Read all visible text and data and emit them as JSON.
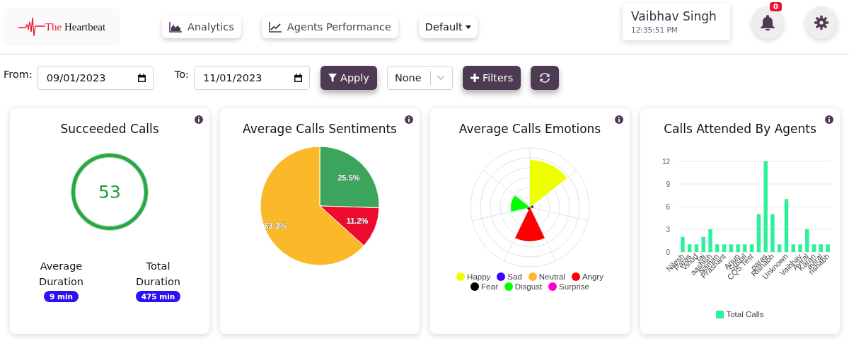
{
  "logo": {
    "prefix": "The",
    "name": "Heartbeat"
  },
  "nav": [
    {
      "label": "Analytics",
      "kind": "area"
    },
    {
      "label": "Agents Performance",
      "kind": "line"
    },
    {
      "label": "Default",
      "kind": "dropdown"
    }
  ],
  "user": {
    "name": "Vaibhav Singh",
    "time": "12:35:51 PM"
  },
  "notifications": {
    "count": "0"
  },
  "filters": {
    "from_label": "From:",
    "from_value": "09/01/2023",
    "to_label": "To:",
    "to_value": "11/01/2023",
    "apply": "Apply",
    "select_value": "None",
    "filters": "Filters"
  },
  "cards": [
    {
      "kind": "summary",
      "title": "Succeeded Calls",
      "value": "53",
      "stats": [
        {
          "label": "Average Duration",
          "value": "9 min"
        },
        {
          "label": "Total Duration",
          "value": "475 min"
        }
      ]
    },
    {
      "kind": "pie",
      "title": "Average Calls Sentiments",
      "chart_data": {
        "type": "pie",
        "values": [
          25.5,
          11.2,
          63.3
        ],
        "data_labels": true,
        "value_labels": [
          "25.5%",
          "11.2%",
          "63.3%"
        ]
      }
    },
    {
      "kind": "polar",
      "title": "Average Calls Emotions",
      "legend": [
        {
          "label": "Happy",
          "color": "#eeff00"
        },
        {
          "label": "Sad",
          "color": "#3c00ff"
        },
        {
          "label": "Neutral",
          "color": "#fbb829"
        },
        {
          "label": "Angry",
          "color": "#ff0000"
        },
        {
          "label": "Fear",
          "color": "#000000"
        },
        {
          "label": "Disgust",
          "color": "#00ff00"
        },
        {
          "label": "Surprise",
          "color": "#ff00cc"
        }
      ]
    },
    {
      "kind": "bar",
      "title": "Calls Attended By Agents",
      "chart_data": {
        "type": "bar",
        "categories": [
          "Nilesh",
          "Paras",
          "Vinod",
          "Jai",
          "aashish",
          "Naman",
          "Prashant",
          null,
          "Arjun",
          "Sushil",
          "CQS Test",
          null,
          "paras",
          "Rishabh",
          null,
          "Unknown",
          null,
          "Vaibhav",
          "Aviral",
          "Karan",
          "aviral",
          "rishabh"
        ],
        "series": [
          {
            "name": "Total Calls",
            "color": "#2cf09a",
            "values": [
              2,
              1,
              1,
              2,
              3,
              1,
              1,
              1,
              1,
              1,
              1,
              5,
              12,
              5,
              1,
              7,
              1,
              1,
              3,
              1,
              1,
              1
            ]
          }
        ],
        "ylim": [
          0,
          12
        ],
        "yticks": [
          0,
          3,
          6,
          9,
          12
        ],
        "grid": true
      }
    }
  ]
}
